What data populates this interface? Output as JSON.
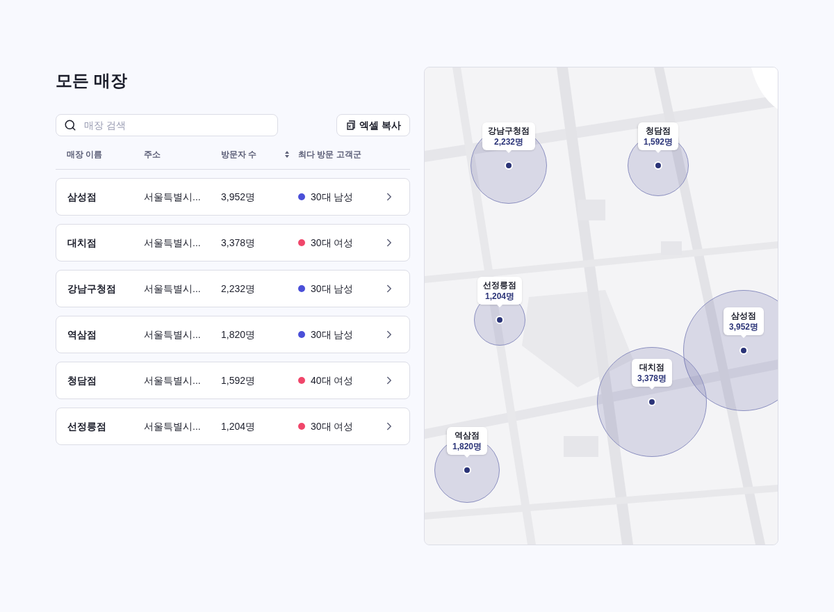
{
  "title": "모든 매장",
  "search": {
    "placeholder": "매장 검색"
  },
  "copy_button": {
    "label": "엑셀 복사"
  },
  "table": {
    "columns": [
      {
        "label": "매장 이름",
        "sortable": false
      },
      {
        "label": "주소",
        "sortable": false
      },
      {
        "label": "방문자 수",
        "sortable": true
      },
      {
        "label": "최다 방문 고객군",
        "sortable": false
      }
    ],
    "rows": [
      {
        "name": "삼성점",
        "address": "서울특별시...",
        "visitors": "3,952명",
        "segment": "30대 남성",
        "color": "#4a4fd8"
      },
      {
        "name": "대치점",
        "address": "서울특별시...",
        "visitors": "3,378명",
        "segment": "30대 여성",
        "color": "#f0466a"
      },
      {
        "name": "강남구청점",
        "address": "서울특별시...",
        "visitors": "2,232명",
        "segment": "30대 남성",
        "color": "#4a4fd8"
      },
      {
        "name": "역삼점",
        "address": "서울특별시...",
        "visitors": "1,820명",
        "segment": "30대 남성",
        "color": "#4a4fd8"
      },
      {
        "name": "청담점",
        "address": "서울특별시...",
        "visitors": "1,592명",
        "segment": "40대 여성",
        "color": "#f0466a"
      },
      {
        "name": "선정릉점",
        "address": "서울특별시...",
        "visitors": "1,204명",
        "segment": "30대 여성",
        "color": "#f0466a"
      }
    ]
  },
  "map": {
    "kind": "picture",
    "markers": [
      {
        "name": "강남구청점",
        "visitors": "2,232명"
      },
      {
        "name": "청담점",
        "visitors": "1,592명"
      },
      {
        "name": "선정릉점",
        "visitors": "1,204명"
      },
      {
        "name": "삼성점",
        "visitors": "3,952명"
      },
      {
        "name": "대치점",
        "visitors": "3,378명"
      },
      {
        "name": "역삼점",
        "visitors": "1,820명"
      }
    ]
  }
}
